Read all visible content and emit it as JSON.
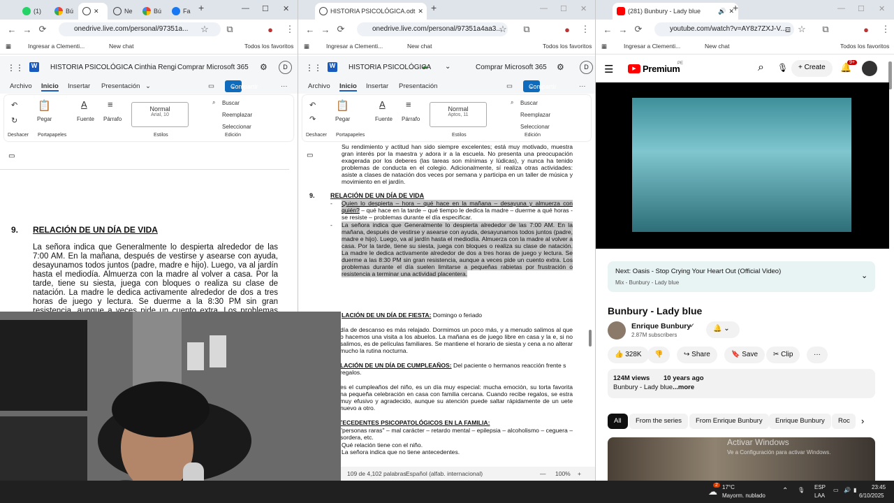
{
  "browser1": {
    "tabs": [
      "(1)",
      "Bú",
      "",
      "Ne",
      "Bú",
      "Fa"
    ],
    "url": "onedrive.live.com/personal/97351a...",
    "bookmarks": [
      "Ingresar a Clementi...",
      "New chat",
      "Todos los favoritos"
    ],
    "doc_title": "HISTORIA PSICOLÓGICA Cinthia Rengi",
    "buy_label": "Comprar Microsoft 365",
    "avatar_letter": "D",
    "menu": [
      "Archivo",
      "Inicio",
      "Insertar",
      "Presentación"
    ],
    "share_label": "Compartir",
    "ribbon": {
      "undo": "Deshacer",
      "paste": "Pegar",
      "clipboard": "Portapapeles",
      "font": "Fuente",
      "paragraph": "Párrafo",
      "style_name": "Normal",
      "style_font": "Arial, 10",
      "styles": "Estilos",
      "find": "Buscar",
      "replace": "Reemplazar",
      "select": "Seleccionar",
      "editing": "Edición"
    },
    "section_number": "9.",
    "section_title": "RELACIÓN DE UN DÍA DE VIDA",
    "body": "La señora indica que Generalmente lo despierta alrededor de las 7:00 AM. En la mañana, después de vestirse y asearse con ayuda, desayunamos todos juntos (padre, madre e hijo). Luego, va al jardín hasta el mediodía. Almuerza con la madre al volver a casa. Por la tarde, tiene su siesta, juega con bloques o realiza su clase de natación. La madre le dedica activamente alrededor de dos a tres horas de juego y lectura. Se duerme a la 8:30 PM sin gran resistencia, aunque a veces pide un cuento extra. Los problemas durante el día suelen limitarse a"
  },
  "browser2": {
    "tab_title": "HISTORIA PSICOLÓGICA.odt",
    "url": "onedrive.live.com/personal/97351a4aa3...",
    "bookmarks": [
      "Ingresar a Clementi...",
      "New chat",
      "Todos los favoritos"
    ],
    "doc_title": "HISTORIA PSICOLÓGICA",
    "buy_label": "Comprar Microsoft 365",
    "avatar_letter": "D",
    "menu": [
      "Archivo",
      "Inicio",
      "Insertar",
      "Presentación"
    ],
    "share_label": "Compartir",
    "ribbon": {
      "undo": "Deshacer",
      "paste": "Pegar",
      "clipboard": "Portapapeles",
      "font": "Fuente",
      "paragraph": "Párrafo",
      "style_name": "Normal",
      "style_font": "Aptos, 11",
      "styles": "Estilos",
      "find": "Buscar",
      "replace": "Reemplazar",
      "select": "Seleccionar",
      "editing": "Edición"
    },
    "p_intro": "Su rendimiento y actitud han sido siempre excelentes; está muy motivado, muestra gran interés por la maestra y adora ir a la escuela. No presenta una preocupación exagerada por los deberes (las tareas son mínimas y lúdicas), y nunca ha tenido problemas de conducta en el colegio. Adicionalmente, sí realiza otras actividades: asiste a clases de natación dos veces por semana y participa en un taller de música y movimiento en el jardín.",
    "sec9_num": "9.",
    "sec9_title": "RELACIÓN DE UN DÍA DE VIDA",
    "sec9_q_underlined": "Quien lo despierta – hora – qué hace en la mañana – desayuna y almuerza con quién?",
    "sec9_q_rest": "– qué hace en la tarde – qué tiempo le dedica la madre – duerme a qué horas - se resiste – problemas durante el día especificar.",
    "sec9_answer": "La señora indica que Generalmente lo despierta alrededor de las 7:00 AM. En la mañana, después de vestirse y asearse con ayuda, desayunamos todos juntos (padre, madre e hijo). Luego, va al jardín hasta el mediodía. Almuerza con la madre al volver a casa. Por la tarde, tiene su siesta, juega con bloques o realiza su clase de natación. La madre le dedica activamente alrededor de dos a tres horas de juego y lectura. Se duerme a las 8:30 PM sin gran resistencia, aunque a veces pide un cuento extra. Los problemas durante el día suelen limitarse a pequeñas rabietas por frustración o resistencia a terminar una actividad placentera.",
    "sec10_title": "LACIÓN DE UN DÍA DE FIESTA:",
    "sec10_sub": "Domingo o feriado",
    "sec10_body": "día de descanso es más relajado. Dormimos un poco más, y a menudo salimos al que o hacemos una visita a los abuelos. La mañana es de juego libre en casa y la e, si no salimos, es de películas familiares. Se mantiene el horario de siesta y cena a no alterar mucho la rutina nocturna.",
    "sec11_title": "LACIÓN DE UN DÍA DE CUMPLEAÑOS:",
    "sec11_sub": "Del paciente o hermanos reacción frente s regalos.",
    "sec11_body": "es el cumpleaños del niño, es un día muy especial: mucha emoción, su torta favorita na pequeña celebración en casa con familia cercana. Cuando recibe regalos, se estra muy efusivo y agradecido, aunque su atención puede saltar rápidamente de un uete nuevo a otro.",
    "sec12_title": "TECEDENTES PSICOPATOLÓGICOS EN LA FAMILIA:",
    "sec12_l1": "\"personas raras\" – mal carácter – retardo mental – epilepsia – alcoholismo – ceguera – sordera, etc.",
    "sec12_l2": "Qué relación tiene con el niño.",
    "sec12_l3": "La señora indica que no tiene antecedentes.",
    "status_words": "109 de 4,102 palabras",
    "status_lang": "Español (alfab. internacional)",
    "zoom": "100%"
  },
  "youtube": {
    "tab_title": "(281) Bunbury - Lady blue",
    "url": "youtube.com/watch?v=AY8z7ZXJ-V...",
    "bookmarks": [
      "Ingresar a Clementi...",
      "New chat",
      "Todos los favoritos"
    ],
    "logo_text": "Premium",
    "logo_region": "PE",
    "create_label": "Create",
    "notif_count": "9+",
    "next_label": "Next: Oasis - Stop Crying Your Heart Out (Official Video)",
    "mix_label": "Mix - Bunbury - Lady blue",
    "video_title": "Bunbury - Lady blue",
    "channel": "Enrique Bunbury",
    "subs": "2.87M subscribers",
    "likes": "328K",
    "share": "Share",
    "save": "Save",
    "clip": "Clip",
    "views": "124M views",
    "age": "10 years ago",
    "desc": "Bunbury - Lady blue",
    "more": "...more",
    "chips": [
      "All",
      "From the series",
      "From Enrique Bunbury",
      "Enrique Bunbury",
      "Roc"
    ],
    "watermark1": "Activar Windows",
    "watermark2": "Ve a Configuración para activar Windows."
  },
  "taskbar": {
    "badge": "2",
    "temp": "17°C",
    "weather": "Mayorm. nublado",
    "lang1": "ESP",
    "lang2": "LAA",
    "time": "23:45",
    "date": "6/10/2025"
  }
}
